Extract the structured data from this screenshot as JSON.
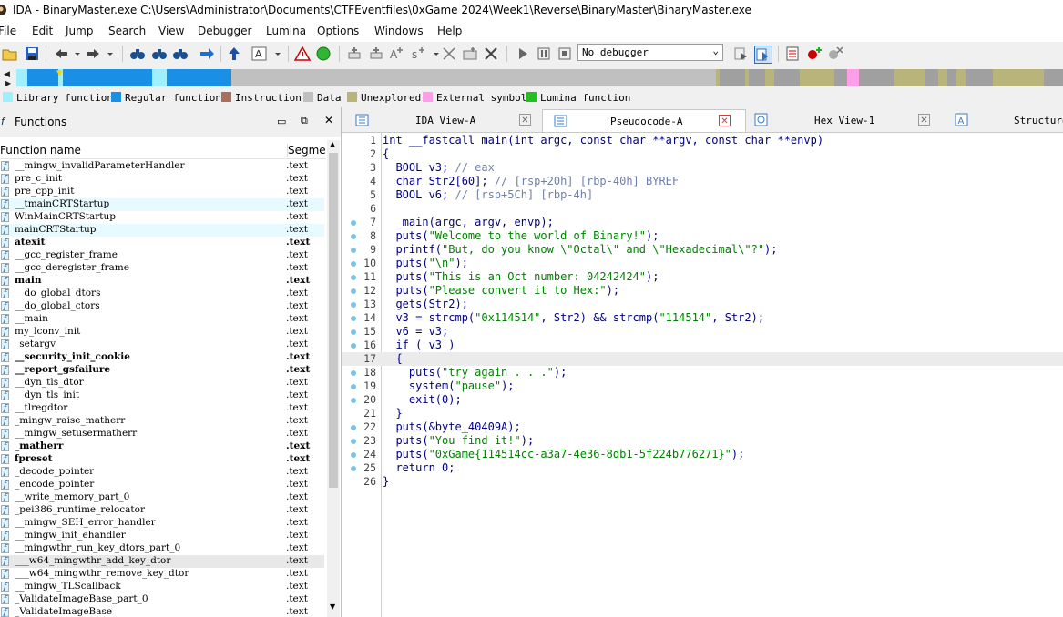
{
  "window": {
    "title": "IDA - BinaryMaster.exe C:\\Users\\Administrator\\Documents\\CTFEventfiles\\0xGame 2024\\Week1\\Reverse\\BinaryMaster\\BinaryMaster.exe"
  },
  "menu": [
    "File",
    "Edit",
    "Jump",
    "Search",
    "View",
    "Debugger",
    "Lumina",
    "Options",
    "Windows",
    "Help"
  ],
  "toolbar": {
    "debugger_select": "No debugger"
  },
  "legend": [
    {
      "label": "Library function",
      "color": "#9ff0ff"
    },
    {
      "label": "Regular function",
      "color": "#1a8fe6"
    },
    {
      "label": "Instruction",
      "color": "#a8705c"
    },
    {
      "label": "Data",
      "color": "#c0c0c0"
    },
    {
      "label": "Unexplored",
      "color": "#b8b47a"
    },
    {
      "label": "External symbol",
      "color": "#ff9ee8"
    },
    {
      "label": "Lumina function",
      "color": "#22c022"
    }
  ],
  "functions_pane": {
    "title": "Functions",
    "col_name": "Function name",
    "col_segment": "Segme",
    "rows": [
      {
        "name": "__mingw_invalidParameterHandler",
        "seg": ".text"
      },
      {
        "name": "pre_c_init",
        "seg": ".text"
      },
      {
        "name": "pre_cpp_init",
        "seg": ".text"
      },
      {
        "name": "__tmainCRTStartup",
        "seg": ".text"
      },
      {
        "name": "WinMainCRTStartup",
        "seg": ".text"
      },
      {
        "name": "mainCRTStartup",
        "seg": ".text"
      },
      {
        "name": "atexit",
        "seg": ".text"
      },
      {
        "name": "__gcc_register_frame",
        "seg": ".text"
      },
      {
        "name": "__gcc_deregister_frame",
        "seg": ".text"
      },
      {
        "name": "main",
        "seg": ".text"
      },
      {
        "name": "__do_global_dtors",
        "seg": ".text"
      },
      {
        "name": "__do_global_ctors",
        "seg": ".text"
      },
      {
        "name": "__main",
        "seg": ".text"
      },
      {
        "name": "my_lconv_init",
        "seg": ".text"
      },
      {
        "name": "_setargv",
        "seg": ".text"
      },
      {
        "name": "__security_init_cookie",
        "seg": ".text"
      },
      {
        "name": "__report_gsfailure",
        "seg": ".text"
      },
      {
        "name": "__dyn_tls_dtor",
        "seg": ".text"
      },
      {
        "name": "__dyn_tls_init",
        "seg": ".text"
      },
      {
        "name": "__tlregdtor",
        "seg": ".text"
      },
      {
        "name": "_mingw_raise_matherr",
        "seg": ".text"
      },
      {
        "name": "__mingw_setusermatherr",
        "seg": ".text"
      },
      {
        "name": "_matherr",
        "seg": ".text"
      },
      {
        "name": "fpreset",
        "seg": ".text"
      },
      {
        "name": "_decode_pointer",
        "seg": ".text"
      },
      {
        "name": "_encode_pointer",
        "seg": ".text"
      },
      {
        "name": "__write_memory_part_0",
        "seg": ".text"
      },
      {
        "name": "_pei386_runtime_relocator",
        "seg": ".text"
      },
      {
        "name": "__mingw_SEH_error_handler",
        "seg": ".text"
      },
      {
        "name": "__mingw_init_ehandler",
        "seg": ".text"
      },
      {
        "name": "__mingwthr_run_key_dtors_part_0",
        "seg": ".text"
      },
      {
        "name": "___w64_mingwthr_add_key_dtor",
        "seg": ".text"
      },
      {
        "name": "___w64_mingwthr_remove_key_dtor",
        "seg": ".text"
      },
      {
        "name": "__mingw_TLScallback",
        "seg": ".text"
      },
      {
        "name": "_ValidateImageBase_part_0",
        "seg": ".text"
      },
      {
        "name": "_ValidateImageBase",
        "seg": ".text"
      }
    ]
  },
  "tabs": [
    {
      "label": "IDA View-A"
    },
    {
      "label": "Pseudocode-A"
    },
    {
      "label": "Hex View-1"
    },
    {
      "label": "Structure"
    }
  ],
  "code": [
    {
      "n": "1",
      "t": "int __fastcall main(int argc, const char **argv, const char **envp)"
    },
    {
      "n": "2",
      "t": "{"
    },
    {
      "n": "3",
      "t": "  BOOL v3; // eax"
    },
    {
      "n": "4",
      "t": "  char Str2[60]; // [rsp+20h] [rbp-40h] BYREF"
    },
    {
      "n": "5",
      "t": "  BOOL v6; // [rsp+5Ch] [rbp-4h]"
    },
    {
      "n": "6",
      "t": ""
    },
    {
      "n": "7",
      "t": "  _main(argc, argv, envp);"
    },
    {
      "n": "8",
      "t": "  puts(\"Welcome to the world of Binary!\");"
    },
    {
      "n": "9",
      "t": "  printf(\"But, do you know \\\"Octal\\\" and \\\"Hexadecimal\\\"?\");"
    },
    {
      "n": "10",
      "t": "  puts(\"\\n\");"
    },
    {
      "n": "11",
      "t": "  puts(\"This is an Oct number: 04242424\");"
    },
    {
      "n": "12",
      "t": "  puts(\"Please convert it to Hex:\");"
    },
    {
      "n": "13",
      "t": "  gets(Str2);"
    },
    {
      "n": "14",
      "t": "  v3 = strcmp(\"0x114514\", Str2) && strcmp(\"114514\", Str2);"
    },
    {
      "n": "15",
      "t": "  v6 = v3;"
    },
    {
      "n": "16",
      "t": "  if ( v3 )"
    },
    {
      "n": "17",
      "t": "  {"
    },
    {
      "n": "18",
      "t": "    puts(\"try again . . .\");"
    },
    {
      "n": "19",
      "t": "    system(\"pause\");"
    },
    {
      "n": "20",
      "t": "    exit(0);"
    },
    {
      "n": "21",
      "t": "  }"
    },
    {
      "n": "22",
      "t": "  puts(&byte_40409A);"
    },
    {
      "n": "23",
      "t": "  puts(\"You find it!\");"
    },
    {
      "n": "24",
      "t": "  puts(\"0xGame{114514cc-a3a7-4e36-8db1-5f224b776271}\");"
    },
    {
      "n": "25",
      "t": "  return 0;"
    },
    {
      "n": "26",
      "t": "}"
    }
  ]
}
